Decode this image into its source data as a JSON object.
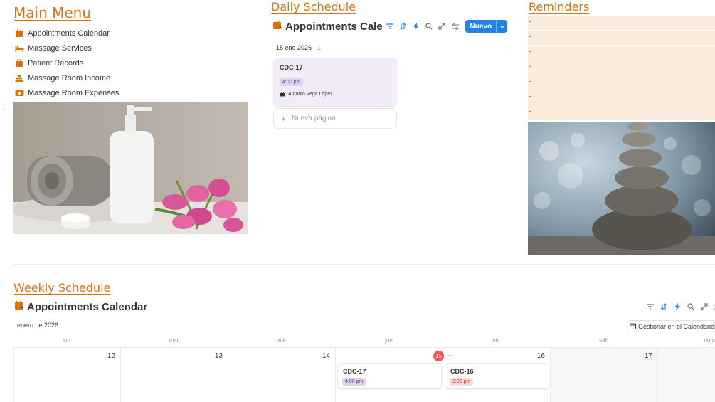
{
  "main_menu": {
    "heading": "Main Menu",
    "items": [
      {
        "label": "Appointments Calendar",
        "icon": "calendar-icon"
      },
      {
        "label": "Massage Services",
        "icon": "massage-bed-icon"
      },
      {
        "label": "Patient Records",
        "icon": "records-icon"
      },
      {
        "label": "Massage Room Income",
        "icon": "income-icon"
      },
      {
        "label": "Massage Room Expenses",
        "icon": "expenses-icon"
      }
    ]
  },
  "daily": {
    "heading": "Daily Schedule",
    "db_title": "Appointments Calendar",
    "new_button": "Nuevo",
    "group_label": "15 ene 2026",
    "group_count": "1",
    "card": {
      "title": "CDC-17",
      "time": "4:00 pm",
      "person": "Antonio Vega López"
    },
    "new_page": "Nueva página"
  },
  "reminders": {
    "heading": "Reminders",
    "items": [
      "-",
      "-",
      "-",
      "-",
      "-",
      "-",
      "-"
    ]
  },
  "weekly": {
    "heading": "Weekly Schedule",
    "db_title": "Appointments Calendar",
    "month": "enero de 2026",
    "gcal_button": "Gestionar en el Calendario",
    "weekdays": [
      "lun",
      "mar",
      "mié",
      "jue",
      "vie",
      "sáb",
      "dom"
    ],
    "days": [
      "12",
      "13",
      "14",
      "15",
      "16",
      "17",
      ""
    ],
    "events": [
      {
        "title": "CDC-17",
        "time": "4:00 pm"
      },
      {
        "title": "CDC-16",
        "time": "3:00 pm"
      }
    ]
  },
  "colors": {
    "accent_orange": "#d9730d",
    "primary_blue": "#2383e2",
    "reminder_bg": "#fbecdd",
    "card_purple": "#f2ecf8",
    "today_red": "#eb5757"
  }
}
